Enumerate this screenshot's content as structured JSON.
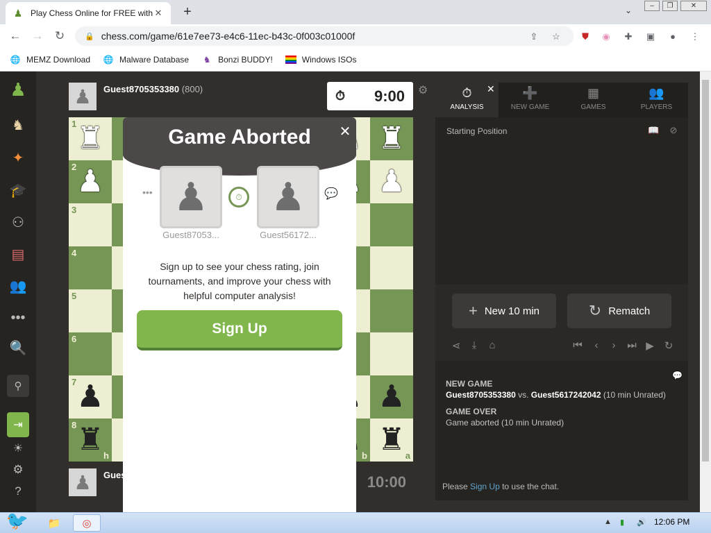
{
  "browser": {
    "tab_title": "Play Chess Online for FREE with F",
    "tab_favicon": "chess-pawn-icon",
    "url": "chess.com/game/61e7ee73-e4c6-11ec-b43c-0f003c01000f",
    "bookmarks": [
      {
        "label": "MEMZ Download",
        "icon": "globe-icon"
      },
      {
        "label": "Malware Database",
        "icon": "globe-icon"
      },
      {
        "label": "Bonzi BUDDY!",
        "icon": "bonzi-icon"
      },
      {
        "label": "Windows ISOs",
        "icon": "windows-flag-icon"
      }
    ]
  },
  "top_player": {
    "name": "Guest8705353380",
    "rating": "(800)",
    "clock": "9:00"
  },
  "bottom_player": {
    "name": "Gues",
    "clock": "10:00"
  },
  "board": {
    "ranks": [
      "1",
      "2",
      "3",
      "4",
      "5",
      "6",
      "7",
      "8"
    ],
    "files_visible": [
      "h",
      "b",
      "a"
    ]
  },
  "modal": {
    "title": "Game Aborted",
    "player1": "Guest87053...",
    "player2": "Guest56172...",
    "message": "Sign up to see your chess rating, join tournaments, and improve your chess with helpful computer analysis!",
    "signup": "Sign Up"
  },
  "panel": {
    "tabs": [
      "ANALYSIS",
      "NEW GAME",
      "GAMES",
      "PLAYERS"
    ],
    "starting_position": "Starting Position",
    "new_button": "New 10 min",
    "rematch_button": "Rematch",
    "new_game_heading": "NEW GAME",
    "new_game_white": "Guest8705353380",
    "new_game_vs": "vs.",
    "new_game_black": "Guest5617242042",
    "new_game_type": "(10 min Unrated)",
    "game_over_heading": "GAME OVER",
    "game_over_text": "Game aborted (10 min Unrated)",
    "chat_prefix": "Please",
    "chat_link": "Sign Up",
    "chat_suffix": "to use the chat."
  },
  "taskbar": {
    "time": "12:06 PM"
  }
}
